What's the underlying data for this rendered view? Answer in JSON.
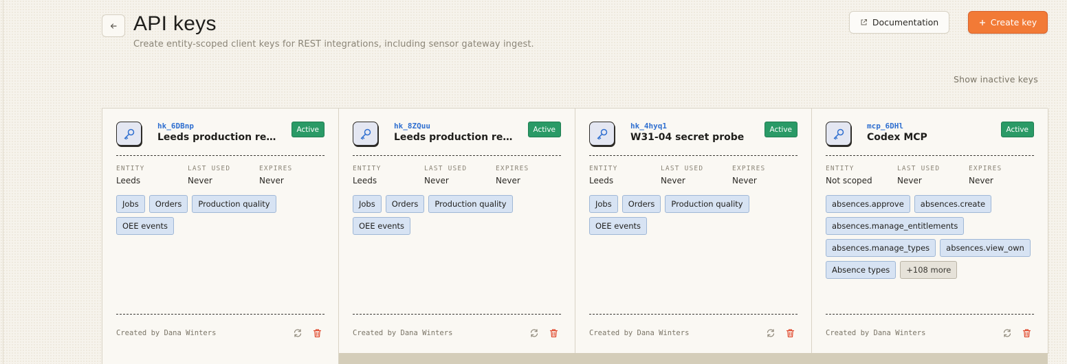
{
  "header": {
    "title": "API keys",
    "subtitle": "Create entity-scoped client keys for REST integrations, including sensor gateway ingest.",
    "documentation_label": "Documentation",
    "create_label": "Create key"
  },
  "show_inactive_label": "Show inactive keys",
  "labels": {
    "entity": "ENTITY",
    "last_used": "LAST USED",
    "expires": "EXPIRES"
  },
  "colors": {
    "accent": "#f27a36",
    "active": "#2a9a66",
    "key_prefix": "#2f6fd0",
    "delete": "#e0472b"
  },
  "keys": [
    {
      "prefix": "hk_6DBnp",
      "name": "Leeds production reporti...",
      "status": "Active",
      "entity": "Leeds",
      "last_used": "Never",
      "expires": "Never",
      "scopes": [
        "Jobs",
        "Orders",
        "Production quality",
        "OEE events"
      ],
      "more": "",
      "created_by": "Created by Dana Winters"
    },
    {
      "prefix": "hk_8ZQuu",
      "name": "Leeds production reporti...",
      "status": "Active",
      "entity": "Leeds",
      "last_used": "Never",
      "expires": "Never",
      "scopes": [
        "Jobs",
        "Orders",
        "Production quality",
        "OEE events"
      ],
      "more": "",
      "created_by": "Created by Dana Winters"
    },
    {
      "prefix": "hk_4hyq1",
      "name": "W31-04 secret probe",
      "status": "Active",
      "entity": "Leeds",
      "last_used": "Never",
      "expires": "Never",
      "scopes": [
        "Jobs",
        "Orders",
        "Production quality",
        "OEE events"
      ],
      "more": "",
      "created_by": "Created by Dana Winters"
    },
    {
      "prefix": "mcp_6DHl",
      "name": "Codex MCP",
      "status": "Active",
      "entity": "Not scoped",
      "last_used": "Never",
      "expires": "Never",
      "scopes": [
        "absences.approve",
        "absences.create",
        "absences.manage_entitlements",
        "absences.manage_types",
        "absences.view_own",
        "Absence types"
      ],
      "more": "+108 more",
      "created_by": "Created by Dana Winters"
    }
  ]
}
